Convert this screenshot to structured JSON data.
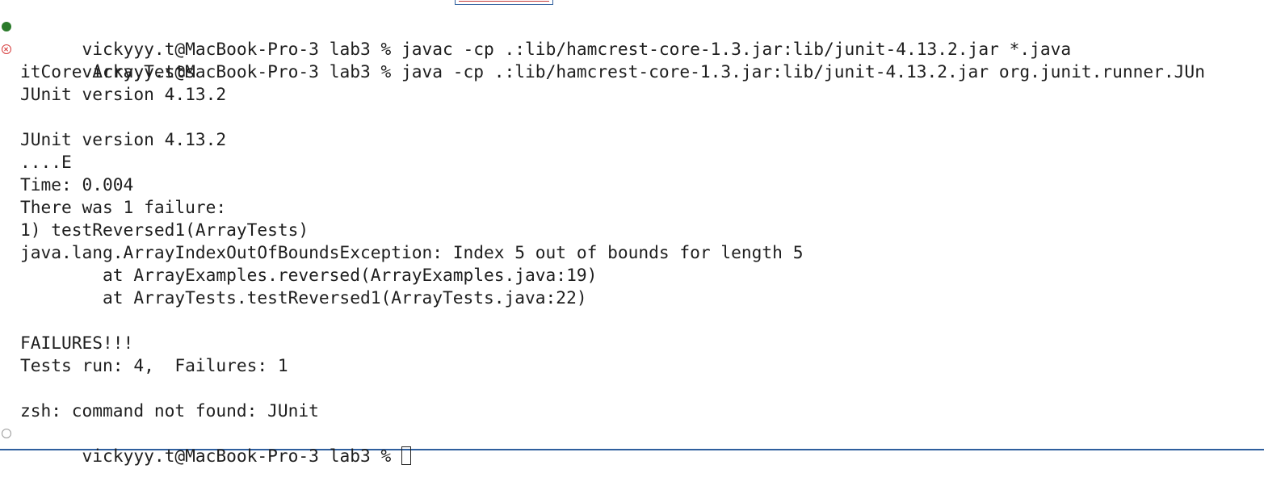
{
  "terminal": {
    "lines": [
      {
        "text": "vickyyy.t@MacBook-Pro-3 lab3 % javac -cp .:lib/hamcrest-core-1.3.jar:lib/junit-4.13.2.jar *.java",
        "marker": "success-dot"
      },
      {
        "text": "vickyyy.t@MacBook-Pro-3 lab3 % java -cp .:lib/hamcrest-core-1.3.jar:lib/junit-4.13.2.jar org.junit.runner.JUn",
        "marker": "error-circle"
      },
      {
        "text": "itCore ArrayTests"
      },
      {
        "text": "JUnit version 4.13.2"
      },
      {
        "text": ""
      },
      {
        "text": "JUnit version 4.13.2"
      },
      {
        "text": "....E"
      },
      {
        "text": "Time: 0.004"
      },
      {
        "text": "There was 1 failure:"
      },
      {
        "text": "1) testReversed1(ArrayTests)"
      },
      {
        "text": "java.lang.ArrayIndexOutOfBoundsException: Index 5 out of bounds for length 5"
      },
      {
        "text": "        at ArrayExamples.reversed(ArrayExamples.java:19)"
      },
      {
        "text": "        at ArrayTests.testReversed1(ArrayTests.java:22)"
      },
      {
        "text": ""
      },
      {
        "text": "FAILURES!!!"
      },
      {
        "text": "Tests run: 4,  Failures: 1"
      },
      {
        "text": ""
      },
      {
        "text": "zsh: command not found: JUnit"
      }
    ],
    "prompt": "vickyyy.t@MacBook-Pro-3 lab3 % ",
    "prompt_marker": "idle-circle",
    "colors": {
      "success": "#2a7a2a",
      "error": "#d63b3b",
      "text": "#1e1e1e",
      "accent": "#2f5f9e"
    }
  }
}
